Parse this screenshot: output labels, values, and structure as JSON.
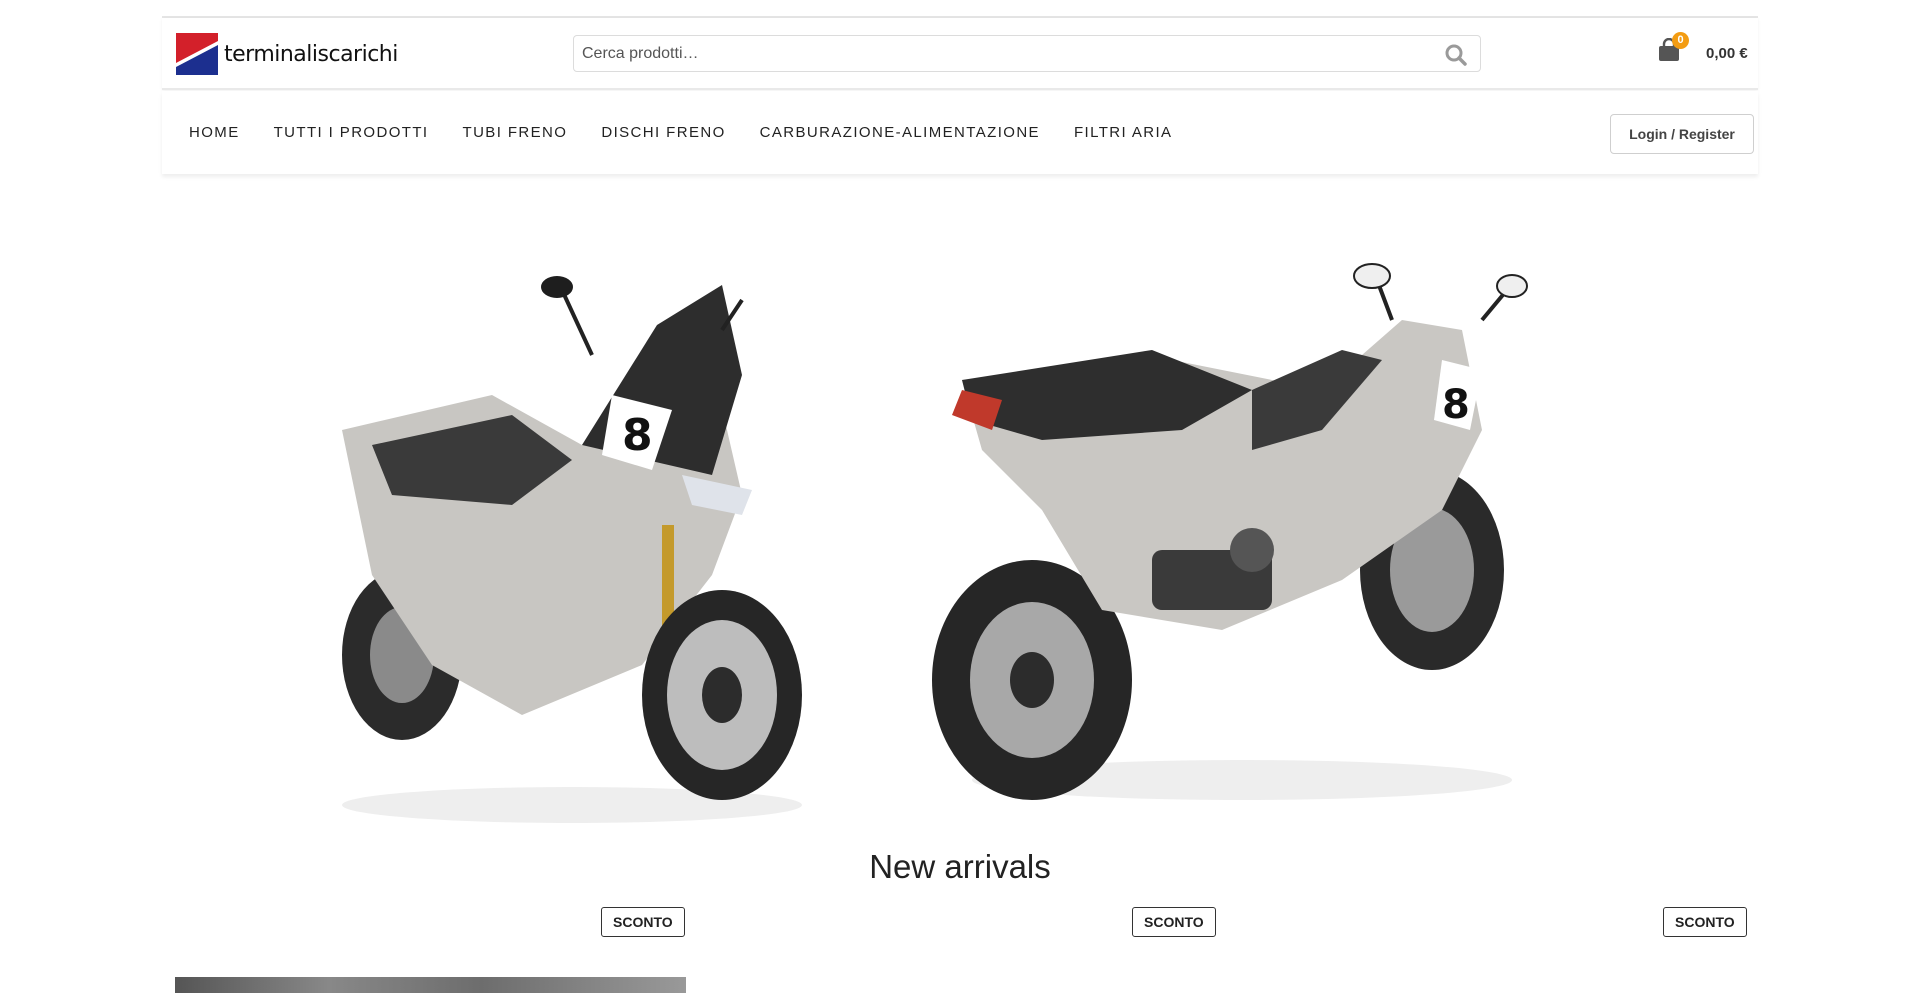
{
  "header": {
    "logo_text": "terminaliscarichi",
    "search": {
      "placeholder": "Cerca prodotti…"
    },
    "cart": {
      "count": "0",
      "total": "0,00 €"
    }
  },
  "nav": {
    "items": [
      {
        "label": "HOME"
      },
      {
        "label": "TUTTI I PRODOTTI"
      },
      {
        "label": "TUBI FRENO"
      },
      {
        "label": "DISCHI FRENO"
      },
      {
        "label": "CARBURAZIONE-ALIMENTAZIONE"
      },
      {
        "label": "FILTRI ARIA"
      }
    ],
    "login_label": "Login / Register"
  },
  "hero": {
    "images": [
      {
        "icon": "scooter-front-image"
      },
      {
        "icon": "scooter-rear-image"
      }
    ]
  },
  "new_arrivals": {
    "title": "New arrivals",
    "badges": [
      "SCONTO",
      "SCONTO",
      "SCONTO"
    ]
  },
  "colors": {
    "accent": "#f39c12",
    "logo_red": "#d3202a",
    "logo_blue": "#1c2f8f"
  }
}
